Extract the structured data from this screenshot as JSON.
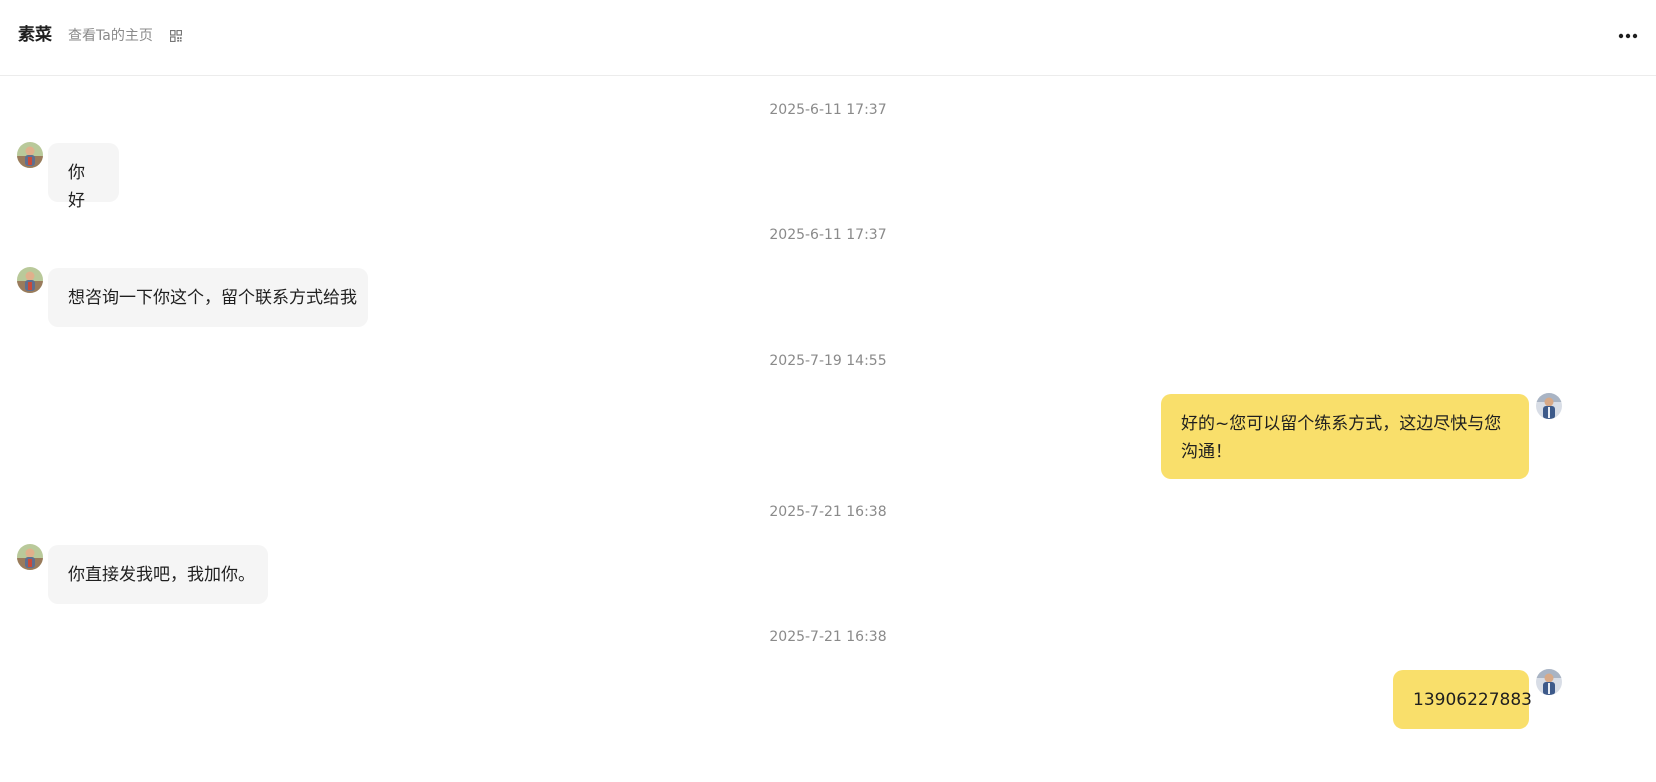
{
  "header": {
    "contact_name": "素菜",
    "homepage_link": "查看Ta的主页",
    "qr_icon": "qr-code-icon",
    "more_icon": "more-horizontal-icon"
  },
  "colors": {
    "incoming_bubble": "#f5f5f5",
    "outgoing_bubble": "#f9df6b",
    "timestamp_text": "#8a8a8a"
  },
  "messages": [
    {
      "time": "2025-6-11 17:37",
      "direction": "incoming",
      "text": "你好"
    },
    {
      "time": "2025-6-11 17:37",
      "direction": "incoming",
      "text": "想咨询一下你这个，留个联系方式给我"
    },
    {
      "time": "2025-7-19 14:55",
      "direction": "outgoing",
      "text": "好的~您可以留个练系方式，这边尽快与您沟通！"
    },
    {
      "time": "2025-7-21 16:38",
      "direction": "incoming",
      "text": "你直接发我吧，我加你。"
    },
    {
      "time": "2025-7-21 16:38",
      "direction": "outgoing",
      "text": "13906227883"
    }
  ]
}
